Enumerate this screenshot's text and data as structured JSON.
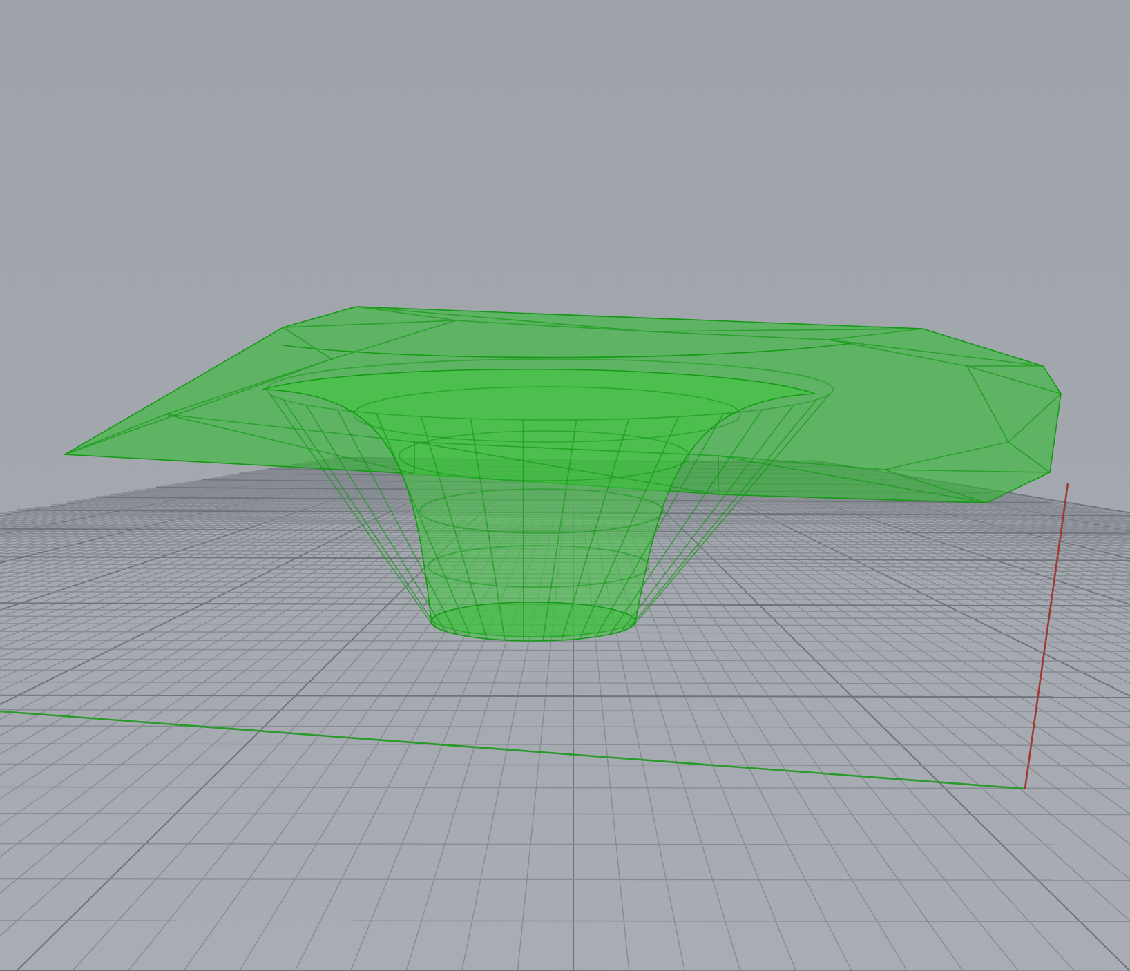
{
  "viewport": {
    "grid": true,
    "axes": true,
    "mesh": true
  }
}
